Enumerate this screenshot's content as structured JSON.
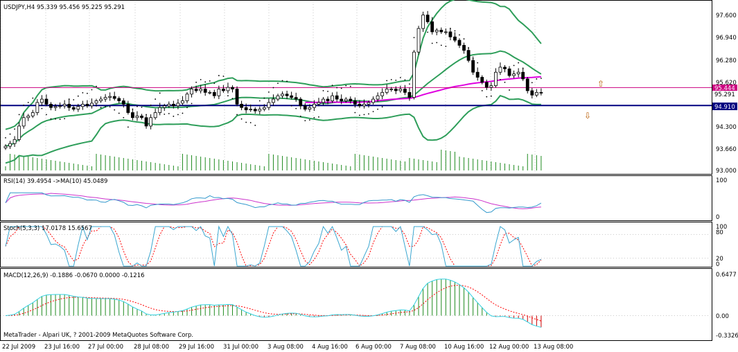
{
  "colors": {
    "background": "#ffffff",
    "frame": "#000000",
    "grid": "#c8c8c8",
    "bull_candle": "#ffffff",
    "bear_candle": "#000000",
    "bollinger": "#2e9e5a",
    "ma": "#e000e0",
    "volume": "#1f8a1f",
    "rsi": "#3399cc",
    "rsi_ma": "#cc33cc",
    "stoch_main": "#3aa6d0",
    "stoch_signal": "#ff0000",
    "macd_hist_up": "#1f8a1f",
    "macd_hist_down": "#cc0000",
    "macd_main": "#33d0e0",
    "macd_signal": "#ff0000",
    "line_upper": "#cc0080",
    "line_lower": "#000080",
    "arrow": "#b85a00"
  },
  "main_panel": {
    "header": "USDJPY,H4  95.339 95.456 95.225 95.291",
    "y_ticks": [
      "97.600",
      "96.940",
      "96.280",
      "95.620",
      "94.300",
      "93.660",
      "93.000"
    ],
    "price_tag_upper": "95.444",
    "price_tag_current": "95.291",
    "price_tag_lower": "94.910",
    "arrow_up": "⇧",
    "arrow_down": "⇩"
  },
  "rsi_panel": {
    "header": "RSI(14) 39.4954 ->MA(10) 45.0489",
    "y_ticks": [
      "100",
      "0"
    ]
  },
  "stoch_panel": {
    "header": "Stoch(5,3,3) 17.0178 15.6567",
    "y_ticks": [
      "100",
      "80",
      "20",
      "0"
    ]
  },
  "macd_panel": {
    "header": "MACD(12,26,9) -0.1886 -0.0670 0.0000 -0.1216",
    "y_ticks": [
      "0.6477",
      "0.00",
      "-0.3326"
    ],
    "copyright": "MetaTrader - Alpari UK, ? 2001-2009 MetaQuotes Software Corp."
  },
  "x_ticks": [
    "22 Jul 2009",
    "23 Jul 16:00",
    "27 Jul 00:00",
    "28 Jul 08:00",
    "29 Jul 16:00",
    "31 Jul 00:00",
    "3 Aug 08:00",
    "4 Aug 16:00",
    "6 Aug 00:00",
    "7 Aug 08:00",
    "10 Aug 16:00",
    "12 Aug 00:00",
    "13 Aug 08:00"
  ],
  "chart_data": [
    {
      "type": "candlestick",
      "symbol": "USDJPY",
      "timeframe": "H4",
      "ohlc_last": {
        "open": 95.339,
        "high": 95.456,
        "low": 95.225,
        "close": 95.291
      },
      "ylim": [
        93.0,
        97.8
      ],
      "horizontal_lines": [
        95.444,
        94.91
      ],
      "closes": [
        93.7,
        93.78,
        93.9,
        94.3,
        94.55,
        94.6,
        94.7,
        95.0,
        95.1,
        94.95,
        94.85,
        94.88,
        94.9,
        94.95,
        94.85,
        94.8,
        94.88,
        94.95,
        94.9,
        94.98,
        95.05,
        95.1,
        95.15,
        95.18,
        95.12,
        95.05,
        94.95,
        94.7,
        94.55,
        94.6,
        94.55,
        94.3,
        94.55,
        94.7,
        94.85,
        94.9,
        94.95,
        94.9,
        94.98,
        95.05,
        95.25,
        95.4,
        95.35,
        95.4,
        95.3,
        95.3,
        95.2,
        95.4,
        95.35,
        95.45,
        95.4,
        94.95,
        94.85,
        94.78,
        94.8,
        94.75,
        94.8,
        94.85,
        95.0,
        95.1,
        95.2,
        95.25,
        95.2,
        95.15,
        95.1,
        94.9,
        94.8,
        94.85,
        94.95,
        95.0,
        95.1,
        95.05,
        95.2,
        95.1,
        95.05,
        95.1,
        95.05,
        94.95,
        94.9,
        94.95,
        95.0,
        95.1,
        95.2,
        95.3,
        95.4,
        95.4,
        95.35,
        95.4,
        95.3,
        95.15,
        96.5,
        97.2,
        97.6,
        97.4,
        97.1,
        97.15,
        97.1,
        97.1,
        96.95,
        96.85,
        96.7,
        96.55,
        96.25,
        95.9,
        95.75,
        95.6,
        95.45,
        95.5,
        95.9,
        96.05,
        96.0,
        95.8,
        95.85,
        95.9,
        95.7,
        95.35,
        95.22,
        95.3,
        95.29
      ],
      "volume_max": 3000,
      "rsi": {
        "period": 14,
        "value": 39.4954,
        "ma_period": 10,
        "ma_value": 45.0489,
        "ylim": [
          0,
          100
        ]
      },
      "stochastic": {
        "params": [
          5,
          3,
          3
        ],
        "main": 17.0178,
        "signal": 15.6567,
        "ylim": [
          0,
          100
        ],
        "levels": [
          80,
          20
        ]
      },
      "macd": {
        "params": [
          12,
          26,
          9
        ],
        "values": [
          -0.1886,
          -0.067,
          0.0,
          -0.1216
        ],
        "ylim": [
          -0.3326,
          0.6477
        ]
      }
    }
  ]
}
